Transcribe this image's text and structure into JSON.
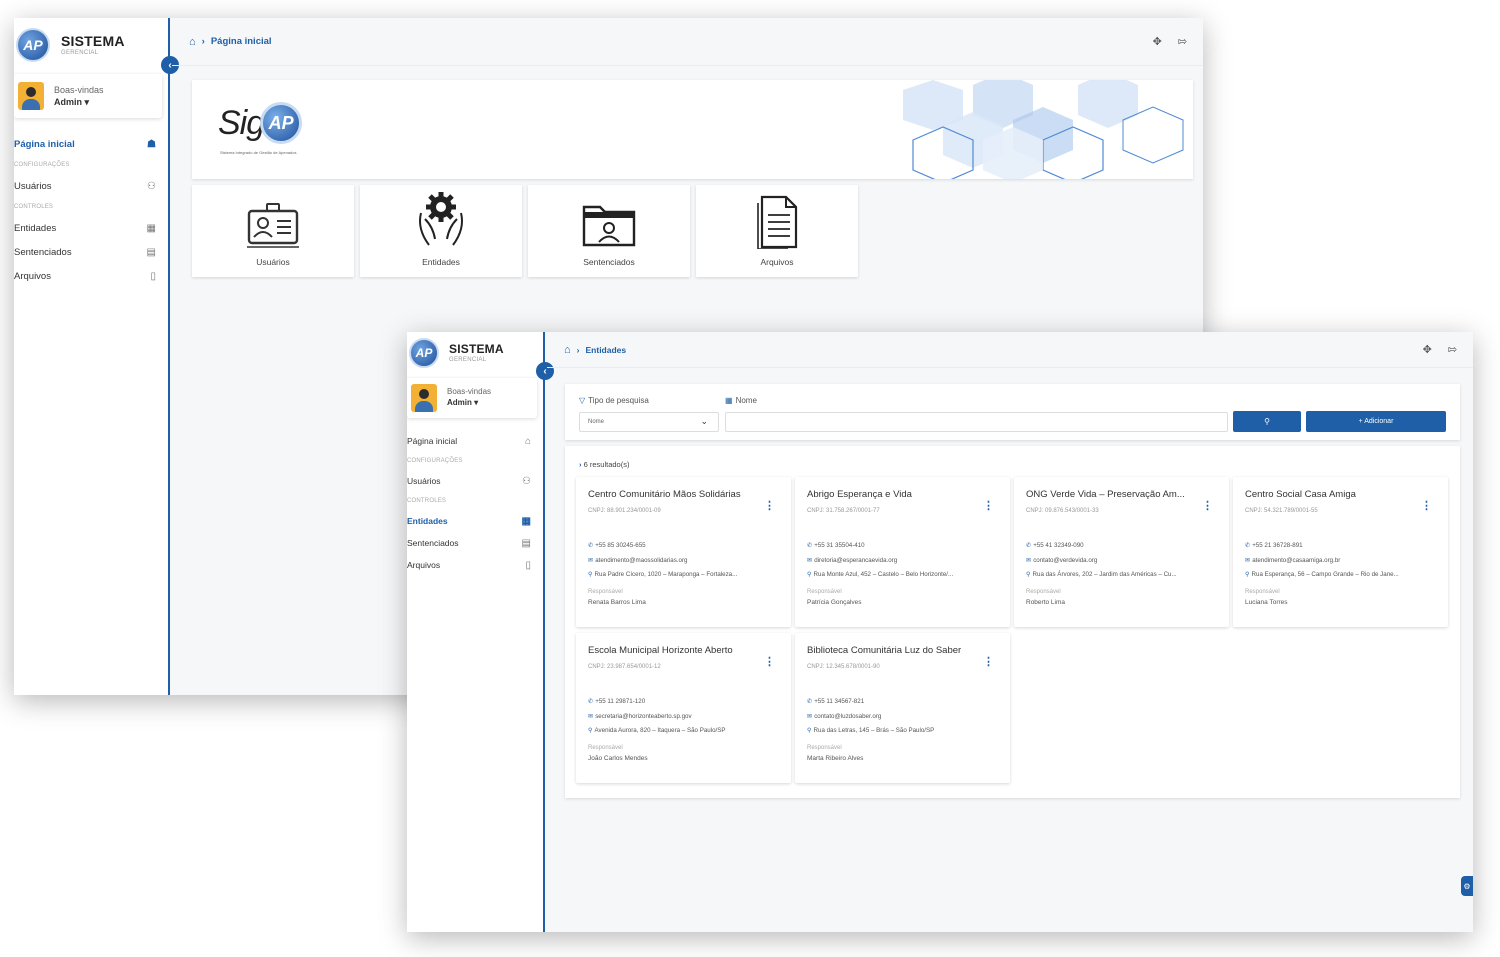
{
  "app": {
    "title": "SISTEMA",
    "subtitle": "GERENCIAL",
    "logo": "AP"
  },
  "user": {
    "greeting": "Boas-vindas",
    "name": "Admin ▾"
  },
  "nav": {
    "home": "Página inicial",
    "section_config": "CONFIGURAÇÕES",
    "users": "Usuários",
    "section_controls": "CONTROLES",
    "entities": "Entidades",
    "sentenced": "Sentenciados",
    "files": "Arquivos"
  },
  "home_page": {
    "breadcrumb": "Página inicial",
    "banner": {
      "logo_text": "Sig",
      "logo_badge": "AP",
      "tagline": "Sistema Integrado de Gestão de Apenados"
    },
    "tiles": [
      {
        "label": "Usuários",
        "icon": "id-card-icon"
      },
      {
        "label": "Entidades",
        "icon": "gear-hands-icon"
      },
      {
        "label": "Sentenciados",
        "icon": "folder-user-icon"
      },
      {
        "label": "Arquivos",
        "icon": "document-icon"
      }
    ]
  },
  "entities_page": {
    "breadcrumb": "Entidades",
    "search": {
      "type_label": "Tipo de pesquisa",
      "name_label": "Nome",
      "select_value": "Nome",
      "add_label": "+ Adicionar"
    },
    "results_count": "6 resultado(s)",
    "responsible_label": "Responsável",
    "cards": [
      {
        "name": "Centro Comunitário Mãos Solidárias",
        "cnpj": "CNPJ: 88.901.234/0001-09",
        "phone": "+55 85 30245-655",
        "email": "atendimento@maossolidarias.org",
        "address": "Rua Padre Cícero, 1020 – Maraponga – Fortaleza...",
        "responsible": "Renata Barros Lima"
      },
      {
        "name": "Abrigo Esperança e Vida",
        "cnpj": "CNPJ: 31.758.267/0001-77",
        "phone": "+55 31 35504-410",
        "email": "diretoria@esperancaevida.org",
        "address": "Rua Monte Azul, 452 – Castelo – Belo Horizonte/...",
        "responsible": "Patrícia Gonçalves"
      },
      {
        "name": "ONG Verde Vida – Preservação Am...",
        "cnpj": "CNPJ: 09.876.543/0001-33",
        "phone": "+55 41 32349-090",
        "email": "contato@verdevida.org",
        "address": "Rua das Árvores, 202 – Jardim das Américas – Cu...",
        "responsible": "Roberto Lima"
      },
      {
        "name": "Centro Social Casa Amiga",
        "cnpj": "CNPJ: 54.321.789/0001-55",
        "phone": "+55 21 36728-891",
        "email": "atendimento@casaamiga.org.br",
        "address": "Rua Esperança, 56 – Campo Grande – Rio de Jane...",
        "responsible": "Luciana Torres"
      },
      {
        "name": "Escola Municipal Horizonte Aberto",
        "cnpj": "CNPJ: 23.987.654/0001-12",
        "phone": "+55 11 29871-120",
        "email": "secretaria@horizonteaberto.sp.gov",
        "address": "Avenida Aurora, 820 – Itaquera – São Paulo/SP",
        "responsible": "João Carlos Mendes"
      },
      {
        "name": "Biblioteca Comunitária Luz do Saber",
        "cnpj": "CNPJ: 12.345.678/0001-90",
        "phone": "+55 11 34567-821",
        "email": "contato@luzdosaber.org",
        "address": "Rua das Letras, 145 – Brás – São Paulo/SP",
        "responsible": "Marta Ribeiro Alves"
      }
    ]
  },
  "colors": {
    "primary": "#1e5fa8",
    "background": "#f6f7f9"
  }
}
